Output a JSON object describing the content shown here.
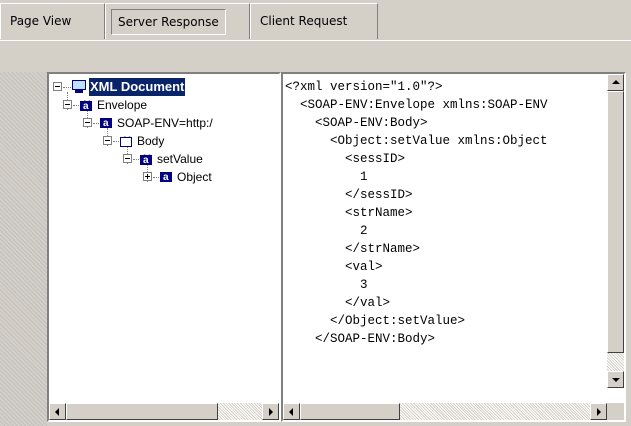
{
  "tabs": [
    {
      "label": "Page View",
      "active": false
    },
    {
      "label": "Server Response",
      "active": true
    },
    {
      "label": "Client Request",
      "active": false
    }
  ],
  "tree": {
    "root": "XML Document",
    "nodes": [
      {
        "label": "Envelope",
        "icon": "element-icon"
      },
      {
        "label": "SOAP-ENV=http:/",
        "icon": "attribute-icon"
      },
      {
        "label": "Body",
        "icon": "element-empty-icon"
      },
      {
        "label": "setValue",
        "icon": "element-icon"
      },
      {
        "label": "Object",
        "icon": "attribute-icon"
      }
    ]
  },
  "xml_lines": [
    "<?xml version=\"1.0\"?>",
    "  <SOAP-ENV:Envelope xmlns:SOAP-ENV",
    "    <SOAP-ENV:Body>",
    "      <Object:setValue xmlns:Object",
    "        <sessID>",
    "          1",
    "        </sessID>",
    "        <strName>",
    "          2",
    "        </strName>",
    "        <val>",
    "          3",
    "        </val>",
    "      </Object:setValue>",
    "    </SOAP-ENV:Body>"
  ],
  "colors": {
    "selection": "#0a246a",
    "window": "#d4d0c8",
    "icon_blue": "#000080"
  }
}
